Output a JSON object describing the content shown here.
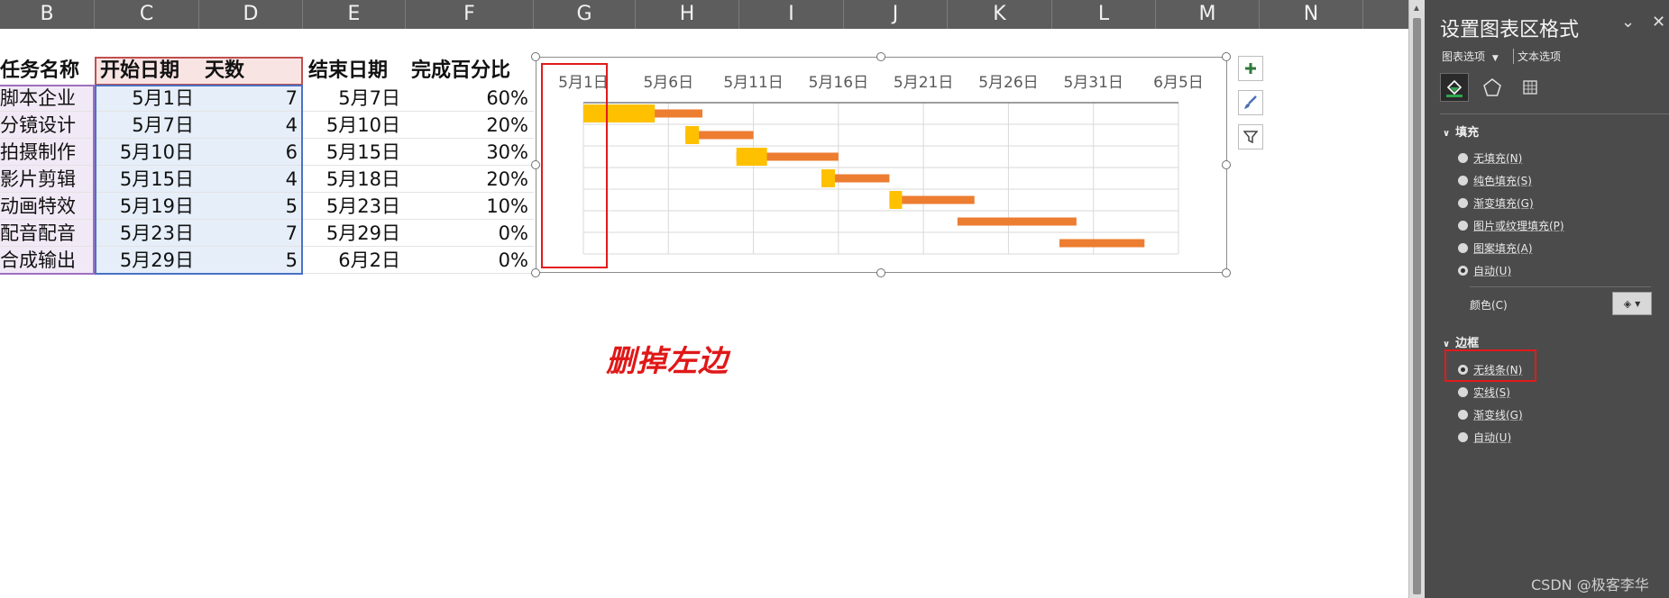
{
  "sheet": {
    "columns": [
      "B",
      "C",
      "D",
      "E",
      "F",
      "G",
      "H",
      "I",
      "J",
      "K",
      "L",
      "M",
      "N"
    ],
    "headers": {
      "task": "任务名称",
      "start": "开始日期",
      "days": "天数",
      "end": "结束日期",
      "pct": "完成百分比"
    },
    "rows": [
      {
        "task": "脚本企业",
        "start": "5月1日",
        "days": "7",
        "end": "5月7日",
        "pct": "60%"
      },
      {
        "task": "分镜设计",
        "start": "5月7日",
        "days": "4",
        "end": "5月10日",
        "pct": "20%"
      },
      {
        "task": "拍摄制作",
        "start": "5月10日",
        "days": "6",
        "end": "5月15日",
        "pct": "30%"
      },
      {
        "task": "影片剪辑",
        "start": "5月15日",
        "days": "4",
        "end": "5月18日",
        "pct": "20%"
      },
      {
        "task": "动画特效",
        "start": "5月19日",
        "days": "5",
        "end": "5月23日",
        "pct": "10%"
      },
      {
        "task": "配音配音",
        "start": "5月23日",
        "days": "7",
        "end": "5月29日",
        "pct": "0%"
      },
      {
        "task": "合成输出",
        "start": "5月29日",
        "days": "5",
        "end": "6月2日",
        "pct": "0%"
      }
    ]
  },
  "chart_data": {
    "type": "bar",
    "orientation": "horizontal-stacked-gantt",
    "x_ticks": [
      "5月1日",
      "5月6日",
      "5月11日",
      "5月16日",
      "5月21日",
      "5月26日",
      "5月31日",
      "6月5日"
    ],
    "x_range_days": [
      0,
      35
    ],
    "categories": [
      "脚本企业",
      "分镜设计",
      "拍摄制作",
      "影片剪辑",
      "动画特效",
      "配音配音",
      "合成输出"
    ],
    "start_day": [
      0,
      6,
      9,
      14,
      18,
      22,
      28
    ],
    "days": [
      7,
      4,
      6,
      4,
      5,
      7,
      5
    ],
    "percent_complete": [
      0.6,
      0.2,
      0.3,
      0.2,
      0.1,
      0,
      0
    ],
    "colors": {
      "completed": "#ffc000",
      "remaining": "#ed7d31",
      "grid": "#d9d9d9"
    },
    "grid": true,
    "legend": "none"
  },
  "chart_buttons": {
    "add": "plus-icon",
    "style": "brush-icon",
    "filter": "filter-icon"
  },
  "annotation": "删掉左边",
  "pane": {
    "title": "设置图表区格式",
    "tab_chart": "图表选项",
    "tab_text": "文本选项",
    "fill_section": "填充",
    "fill_options": [
      {
        "label": "无填充(N)",
        "selected": false
      },
      {
        "label": "纯色填充(S)",
        "selected": false
      },
      {
        "label": "渐变填充(G)",
        "selected": false
      },
      {
        "label": "图片或纹理填充(P)",
        "selected": false
      },
      {
        "label": "图案填充(A)",
        "selected": false
      },
      {
        "label": "自动(U)",
        "selected": true
      }
    ],
    "color_label": "颜色(C)",
    "border_section": "边框",
    "border_options": [
      {
        "label": "无线条(N)",
        "selected": true
      },
      {
        "label": "实线(S)",
        "selected": false
      },
      {
        "label": "渐变线(G)",
        "selected": false
      },
      {
        "label": "自动(U)",
        "selected": false
      }
    ],
    "watermark": "CSDN @极客李华"
  }
}
